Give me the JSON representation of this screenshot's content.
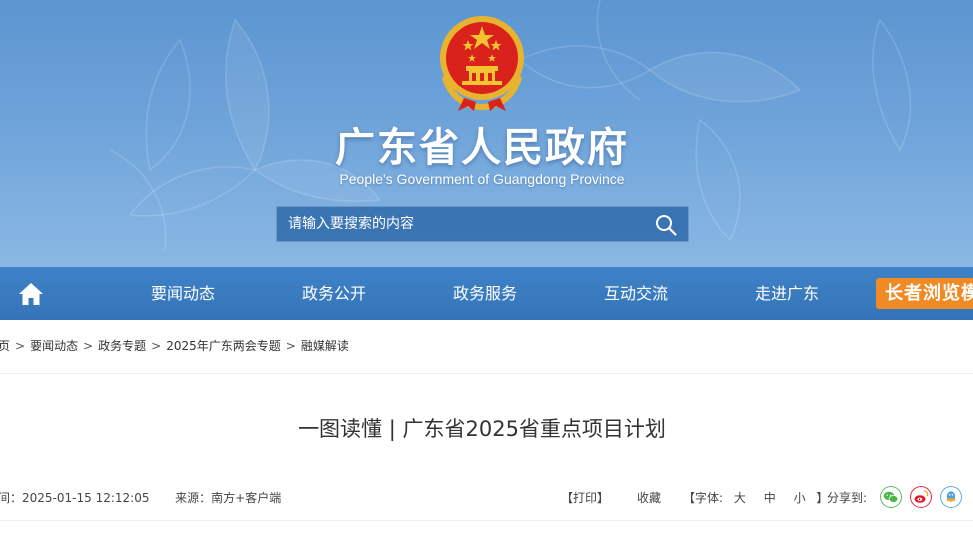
{
  "header": {
    "title": "广东省人民政府",
    "subtitle": "People's Government of Guangdong Province",
    "emblem_icon": "national-emblem-icon",
    "search": {
      "placeholder": "请输入要搜索的内容",
      "icon": "search-icon"
    }
  },
  "nav": {
    "home_icon": "home-icon",
    "items": [
      {
        "label": "要闻动态"
      },
      {
        "label": "政务公开"
      },
      {
        "label": "政务服务"
      },
      {
        "label": "互动交流"
      },
      {
        "label": "走进广东"
      }
    ],
    "elder_label": "长者浏览模式"
  },
  "breadcrumb": {
    "items": [
      "首页",
      "要闻动态",
      "政务专题",
      "2025年广东两会专题",
      "融媒解读"
    ],
    "separator": ">"
  },
  "article": {
    "title": "一图读懂 | 广东省2025省重点项目计划",
    "time_label": "时间：",
    "time": "2025-01-15 12:12:05",
    "source_label": "来源：",
    "source": "南方+客户端",
    "print_label": "【打印】",
    "collect_label": "收藏",
    "font_size_label": "【字体:",
    "font_sizes": [
      "大",
      "中",
      "小"
    ],
    "font_size_close": "】",
    "share_label": "分享到:",
    "share_icons": [
      "wechat-icon",
      "weibo-icon",
      "qq-icon"
    ]
  },
  "colors": {
    "banner_top": "#5c95d1",
    "nav_bg": "#3a7bc0",
    "elder_button": "#f08a24",
    "wechat": "#4cb648",
    "weibo": "#e6162d",
    "qq": "#4aa3df"
  }
}
